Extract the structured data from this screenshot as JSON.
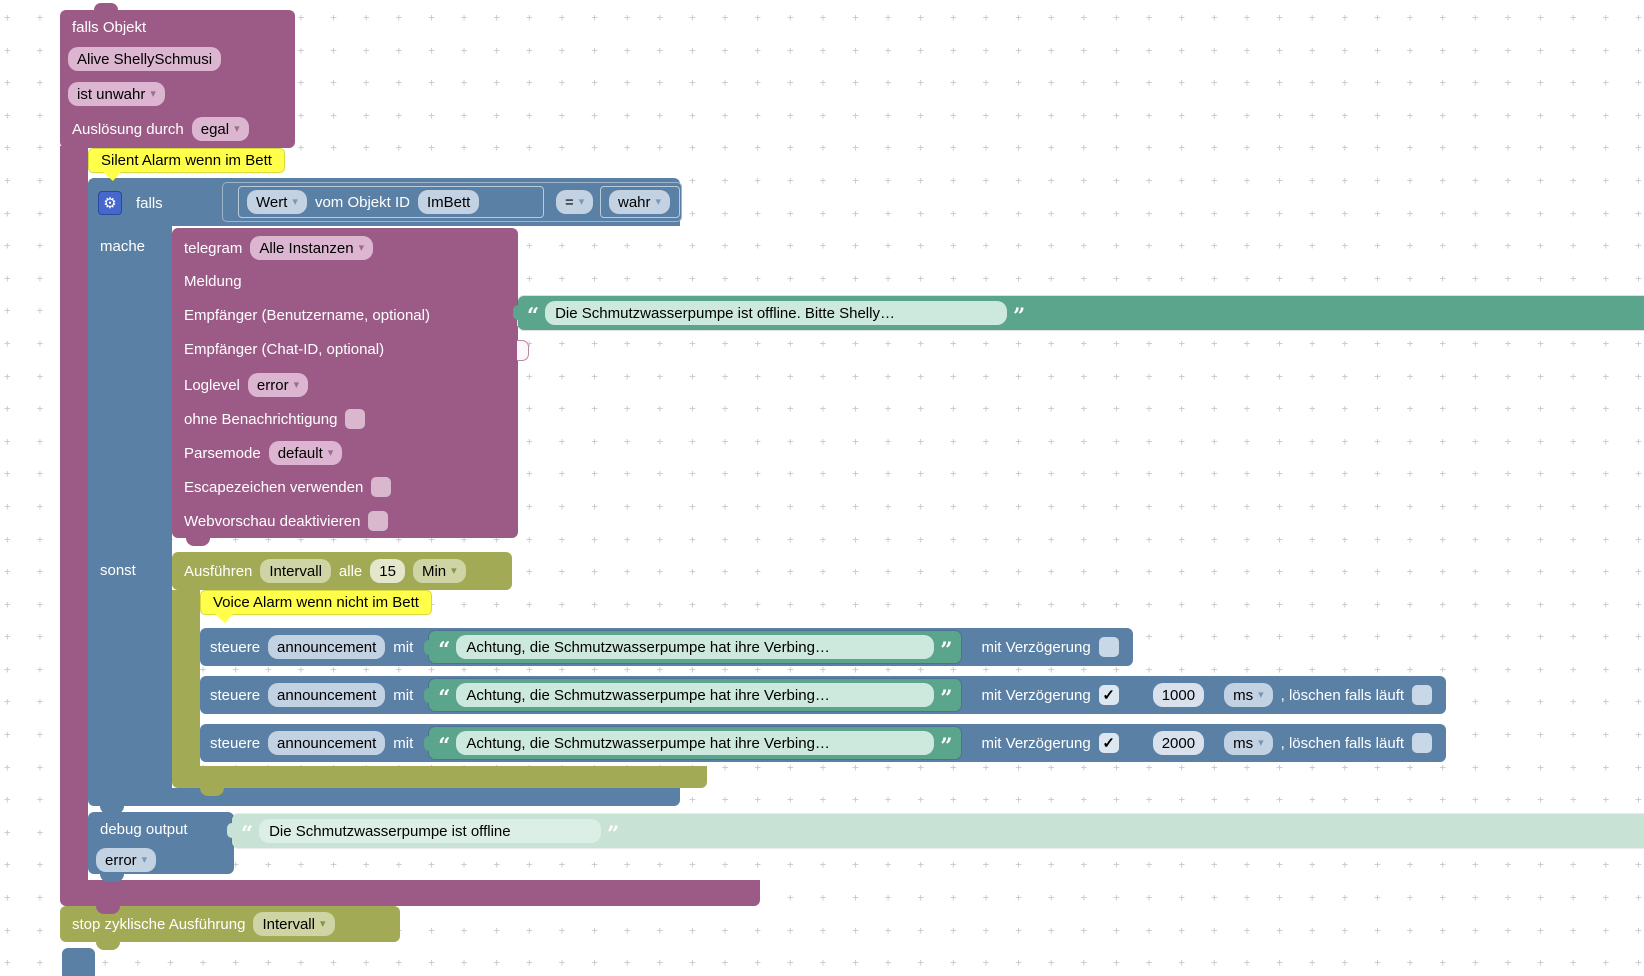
{
  "icons": {
    "gear": "⚙",
    "arrow": "▾",
    "quote_open": "“",
    "quote_close": "”",
    "check": "✓"
  },
  "colors": {
    "trigger_purple": "#9c5b87",
    "logic_blue": "#5b80a5",
    "timeout_olive": "#a3aa55",
    "text_green": "#5ba58c",
    "comment_yellow": "#ffff4a",
    "field_light_purple": "#dcb6d0",
    "field_light_blue": "#c3d2e2",
    "gear_blue": "#4668cc"
  },
  "trigger": {
    "title": "falls Objekt",
    "object": "Alive ShellySchmusi",
    "is_dropdown": "ist unwahr",
    "trigger_label": "Auslösung durch",
    "trigger_value": "egal"
  },
  "comments": {
    "silent": "Silent Alarm wenn im Bett",
    "voice": "Voice Alarm wenn nicht im Bett"
  },
  "if_block": {
    "falls": "falls",
    "mache": "mache",
    "sonst": "sonst"
  },
  "condition": {
    "value_dropdown": "Wert",
    "label": "vom Objekt ID",
    "object_id": "ImBett",
    "operator": "=",
    "compare_value": "wahr"
  },
  "telegram": {
    "name": "telegram",
    "instance": "Alle Instanzen",
    "meldung_label": "Meldung",
    "message": "Die Schmutzwasserpumpe ist offline. Bitte Shelly…",
    "empf_user_label": "Empfänger (Benutzername, optional)",
    "empf_chat_label": "Empfänger (Chat-ID, optional)",
    "loglevel_label": "Loglevel",
    "loglevel": "error",
    "silent_label": "ohne Benachrichtigung",
    "silent_checked": false,
    "parsemode_label": "Parsemode",
    "parsemode": "default",
    "escape_label": "Escapezeichen verwenden",
    "escape_checked": false,
    "webpreview_label": "Webvorschau deaktivieren",
    "webpreview_checked": false
  },
  "interval": {
    "execute": "Ausführen",
    "name": "Intervall",
    "alle": "alle",
    "every": "15",
    "unit": "Min"
  },
  "announce": {
    "steuere": "steuere",
    "object": "announcement",
    "mit": "mit",
    "message": "Achtung, die Schmutzwasserpumpe hat ihre Verbing…",
    "delay_label": "mit Verzögerung",
    "clear_label": ", löschen falls läuft",
    "rows": [
      {
        "delay_checked": false
      },
      {
        "delay_checked": true,
        "delay": "1000",
        "unit": "ms",
        "clear_checked": false
      },
      {
        "delay_checked": true,
        "delay": "2000",
        "unit": "ms",
        "clear_checked": false
      }
    ]
  },
  "debug": {
    "label": "debug output",
    "message": "Die Schmutzwasserpumpe ist offline",
    "level": "error"
  },
  "stop": {
    "label": "stop zyklische Ausführung",
    "value": "Intervall"
  }
}
